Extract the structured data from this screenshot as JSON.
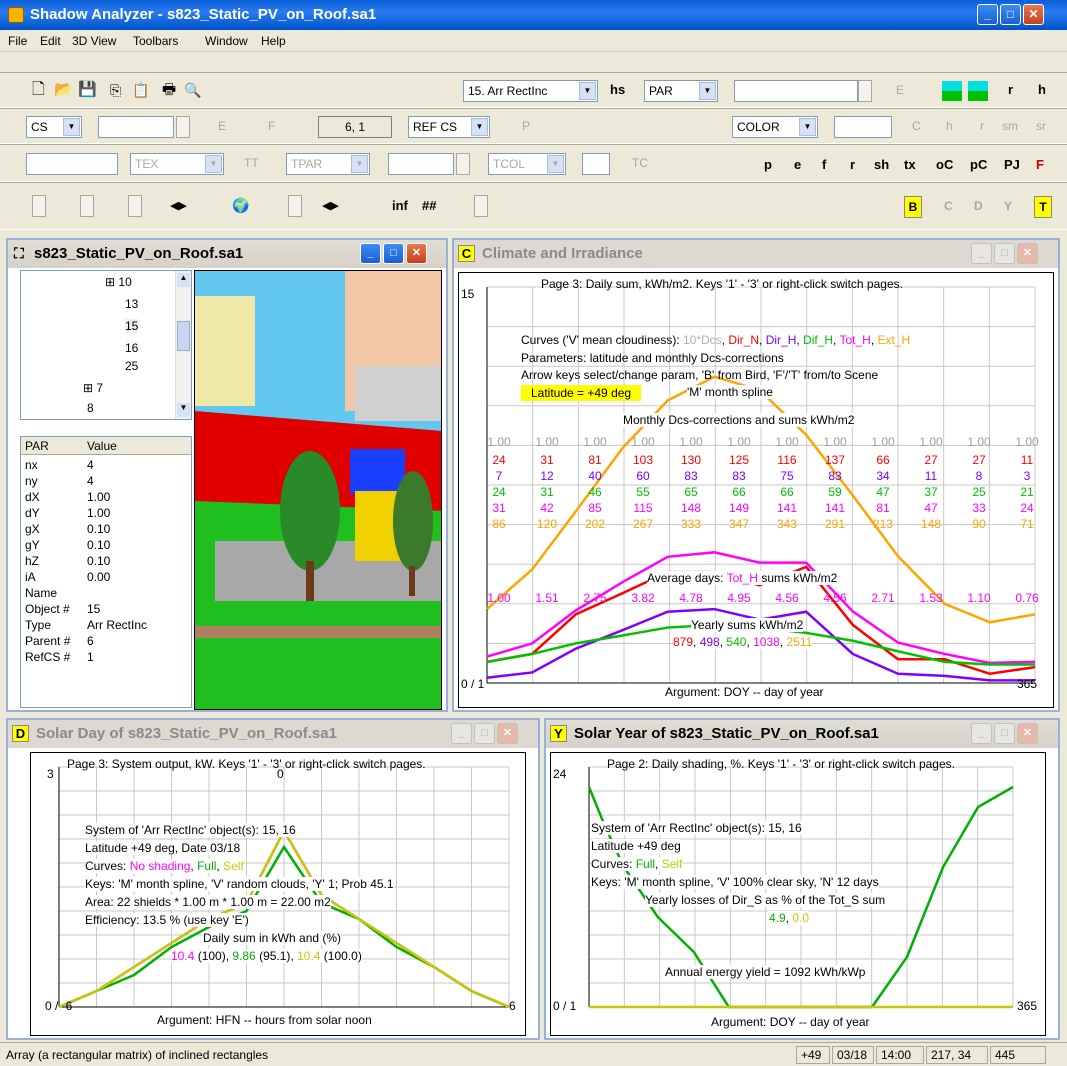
{
  "app": {
    "title": "Shadow Analyzer - s823_Static_PV_on_Roof.sa1"
  },
  "menu": [
    "File",
    "Edit",
    "3D View",
    "Toolbars",
    "Window",
    "Help"
  ],
  "toolbar1": {
    "combo_arr": "15. Arr RectInc",
    "hs": "hs",
    "combo_par": "PAR",
    "e": "E",
    "r": "r",
    "h": "h"
  },
  "toolbar2": {
    "cs": "CS",
    "e": "E",
    "f": "F",
    "coords": "6, 1",
    "refcs": "REF CS",
    "p": "P",
    "color": "COLOR",
    "c": "C",
    "h": "h",
    "r": "r",
    "sm": "sm",
    "sr": "sr"
  },
  "toolbar3": {
    "tex": "TEX",
    "tt": "TT",
    "tpar": "TPAR",
    "tcol": "TCOL",
    "tc": "TC",
    "btns": [
      "p",
      "e",
      "f",
      "r",
      "sh",
      "tx",
      "oC",
      "pC",
      "PJ",
      "F"
    ]
  },
  "toolbar4": {
    "inf": "inf",
    "hash": "##",
    "btns": [
      "B",
      "C",
      "D",
      "Y",
      "T"
    ]
  },
  "scene_window": {
    "title": "s823_Static_PV_on_Roof.sa1",
    "tree": [
      "10",
      "13",
      "15",
      "16",
      "25",
      "7",
      "8"
    ],
    "table_header": [
      "PAR",
      "Value"
    ],
    "rows": [
      [
        "nx",
        "4"
      ],
      [
        "ny",
        "4"
      ],
      [
        "dX",
        "1.00"
      ],
      [
        "dY",
        "1.00"
      ],
      [
        "gX",
        "0.10"
      ],
      [
        "gY",
        "0.10"
      ],
      [
        "hZ",
        "0.10"
      ],
      [
        "iA",
        "0.00"
      ],
      [
        "Name",
        ""
      ],
      [
        "Object #",
        "15"
      ],
      [
        "Type",
        "Arr RectInc"
      ],
      [
        "Parent #",
        "6"
      ],
      [
        "RefCS #",
        "1"
      ]
    ]
  },
  "climate_window": {
    "letter": "C",
    "title": "Climate and Irradiance",
    "header": "Page 3: Daily sum, kWh/m2. Keys '1' - '3' or right-click switch pages.",
    "y_max": "15",
    "origin": "0 / 1",
    "x_max": "365",
    "curves_prefix": "Curves ('V' mean cloudiness): ",
    "curves": [
      {
        "label": "10*Dcs",
        "color": "#b0b0b0"
      },
      {
        "label": "Dir_N",
        "color": "#ff0000"
      },
      {
        "label": "Dir_H",
        "color": "#8000ff"
      },
      {
        "label": "Dif_H",
        "color": "#00c000"
      },
      {
        "label": "Tot_H",
        "color": "#ff00ff"
      },
      {
        "label": "Ext_H",
        "color": "#ffa500"
      }
    ],
    "params": "Parameters: latitude and monthly Dcs-corrections",
    "arrows": "Arrow keys select/change param, 'B' from Bird, 'F'/'T' from/to Scene",
    "latitude": "Latitude = +49 deg",
    "spline": "'M' month spline",
    "monthly_title": "Monthly Dcs-corrections and sums kWh/m2",
    "dcs": [
      "1.00",
      "1.00",
      "1.00",
      "1.00",
      "1.00",
      "1.00",
      "1.00",
      "1.00",
      "1.00",
      "1.00",
      "1.00",
      "1.00"
    ],
    "dir_n": [
      "24",
      "31",
      "81",
      "103",
      "130",
      "125",
      "116",
      "137",
      "66",
      "27",
      "27",
      "11"
    ],
    "dir_h": [
      "7",
      "12",
      "40",
      "60",
      "83",
      "83",
      "75",
      "83",
      "34",
      "11",
      "8",
      "3"
    ],
    "dif_h": [
      "24",
      "31",
      "46",
      "55",
      "65",
      "66",
      "66",
      "59",
      "47",
      "37",
      "25",
      "21"
    ],
    "tot_h": [
      "31",
      "42",
      "85",
      "115",
      "148",
      "149",
      "141",
      "141",
      "81",
      "47",
      "33",
      "24"
    ],
    "ext_h": [
      "86",
      "120",
      "202",
      "267",
      "333",
      "347",
      "343",
      "291",
      "213",
      "148",
      "90",
      "71"
    ],
    "avg_title_prefix": "Average days: ",
    "avg_title_series": "Tot_H",
    "avg_title_suffix": " sums kWh/m2",
    "avg": [
      "1.00",
      "1.51",
      "2.75",
      "3.82",
      "4.78",
      "4.95",
      "4.56",
      "4.56",
      "2.71",
      "1.53",
      "1.10",
      "0.76"
    ],
    "yearly_title": "Yearly sums kWh/m2",
    "yearly": [
      "879",
      "498",
      "540",
      "1038",
      "2511"
    ],
    "xlabel": "Argument: DOY -- day of year"
  },
  "solar_day_window": {
    "letter": "D",
    "title": "Solar Day of s823_Static_PV_on_Roof.sa1",
    "header": "Page 3: System output, kW. Keys '1' - '3' or right-click switch pages.",
    "y_max": "3",
    "top_tick": "0",
    "origin": "0 / -6",
    "x_max": "6",
    "system": "System of 'Arr RectInc' object(s): 15, 16",
    "latitude": "Latitude +49 deg, Date 03/18",
    "curves_prefix": "Curves: ",
    "curves": [
      {
        "label": "No shading",
        "color": "#ff00ff"
      },
      {
        "label": "Full",
        "color": "#00b000"
      },
      {
        "label": "Self",
        "color": "#c8c800"
      }
    ],
    "keys": "Keys: 'M' month spline, 'V' random clouds, 'Y' 1; Prob 45.1",
    "area": "Area: 22 shields * 1.00 m * 1.00 m = 22.00 m2",
    "efficiency": "Efficiency: 13.5 % (use key 'E')",
    "daily_title": "Daily sum in kWh and (%)",
    "daily": [
      {
        "value": "10.4",
        "pct": " (100), ",
        "color": "#ff00ff"
      },
      {
        "value": "9.86",
        "pct": " (95.1), ",
        "color": "#00b000"
      },
      {
        "value": "10.4",
        "pct": " (100.0)",
        "color": "#c8c800"
      }
    ],
    "xlabel": "Argument: HFN -- hours from solar noon"
  },
  "solar_year_window": {
    "letter": "Y",
    "title": "Solar Year of s823_Static_PV_on_Roof.sa1",
    "header": "Page 2: Daily shading, %. Keys '1' - '3' or right-click switch pages.",
    "y_max": "24",
    "origin": "0 / 1",
    "x_max": "365",
    "system": "System of 'Arr RectInc' object(s): 15, 16",
    "latitude": "Latitude +49 deg",
    "curves_prefix": "Curves: ",
    "curves": [
      {
        "label": "Full",
        "color": "#00b000"
      },
      {
        "label": "Self",
        "color": "#c8c800"
      }
    ],
    "keys": "Keys: 'M' month spline, 'V' 100% clear sky, 'N' 12 days",
    "losses": "Yearly losses of Dir_S as % of the Tot_S sum",
    "losses_vals": [
      "4.9",
      "0.0"
    ],
    "annual": "Annual energy yield = 1092 kWh/kWp",
    "xlabel": "Argument: DOY -- day of year"
  },
  "statusbar": {
    "text": "Array (a rectangular matrix) of inclined rectangles",
    "lat": "+49",
    "date": "03/18",
    "time": "14:00",
    "pos": "217, 34",
    "num": "445"
  },
  "chart_data": [
    {
      "type": "line",
      "title": "Page 3: Daily sum, kWh/m2. Keys '1' - '3' or right-click switch pages.",
      "xlabel": "Argument: DOY -- day of year",
      "xlim": [
        1,
        365
      ],
      "ylim": [
        0,
        15
      ],
      "x": [
        1,
        31,
        60,
        91,
        121,
        152,
        182,
        213,
        244,
        274,
        305,
        335,
        365
      ],
      "series": [
        {
          "name": "Ext_H",
          "color": "#ffa500",
          "values": [
            2.8,
            4.3,
            6.5,
            8.9,
            10.7,
            11.6,
            11.1,
            9.4,
            7.1,
            4.8,
            3.0,
            2.3,
            2.6
          ]
        },
        {
          "name": "Tot_H",
          "color": "#ff00ff",
          "values": [
            1.0,
            1.5,
            2.75,
            3.82,
            4.78,
            4.95,
            4.56,
            4.56,
            2.71,
            1.53,
            1.1,
            0.76,
            0.8
          ]
        },
        {
          "name": "Dir_N",
          "color": "#ff0000",
          "values": [
            0.8,
            1.1,
            2.6,
            3.4,
            4.2,
            4.2,
            3.7,
            4.4,
            2.2,
            0.9,
            0.9,
            0.35,
            0.6
          ]
        },
        {
          "name": "Dir_H",
          "color": "#8000ff",
          "values": [
            0.2,
            0.4,
            1.3,
            2.0,
            2.7,
            2.8,
            2.4,
            2.7,
            1.1,
            0.35,
            0.27,
            0.1,
            0.1
          ]
        },
        {
          "name": "Dif_H",
          "color": "#00c000",
          "values": [
            0.8,
            1.1,
            1.5,
            1.8,
            2.1,
            2.2,
            2.1,
            1.9,
            1.6,
            1.2,
            0.8,
            0.7,
            0.7
          ]
        }
      ]
    },
    {
      "type": "line",
      "title": "Page 3: System output, kW. Keys '1' - '3' or right-click switch pages.",
      "xlabel": "Argument: HFN -- hours from solar noon",
      "xlim": [
        -6,
        6
      ],
      "ylim": [
        0,
        3
      ],
      "x": [
        -6,
        -5,
        -4,
        -3,
        -2,
        -1,
        0,
        1,
        2,
        3,
        4,
        5,
        6
      ],
      "series": [
        {
          "name": "No shading",
          "color": "#ff00ff",
          "values": [
            0.0,
            0.2,
            0.5,
            0.8,
            1.1,
            1.3,
            2.2,
            1.4,
            1.1,
            0.8,
            0.5,
            0.2,
            0.0
          ]
        },
        {
          "name": "Full",
          "color": "#00b000",
          "values": [
            0.0,
            0.2,
            0.4,
            0.75,
            1.0,
            1.2,
            2.0,
            1.3,
            1.1,
            0.75,
            0.5,
            0.2,
            0.0
          ]
        },
        {
          "name": "Self",
          "color": "#c8c800",
          "values": [
            0.0,
            0.2,
            0.5,
            0.8,
            1.1,
            1.3,
            2.2,
            1.4,
            1.1,
            0.8,
            0.5,
            0.2,
            0.0
          ]
        }
      ]
    },
    {
      "type": "line",
      "title": "Page 2: Daily shading, %. Keys '1' - '3' or right-click switch pages.",
      "xlabel": "Argument: DOY -- day of year",
      "xlim": [
        1,
        365
      ],
      "ylim": [
        0,
        24
      ],
      "x": [
        1,
        15,
        31,
        60,
        91,
        121,
        152,
        182,
        213,
        244,
        274,
        305,
        335,
        365
      ],
      "series": [
        {
          "name": "Full",
          "color": "#00b000",
          "values": [
            22,
            18,
            14,
            9,
            5.5,
            0,
            0,
            0,
            0,
            0,
            5,
            14,
            20,
            22
          ]
        },
        {
          "name": "Self",
          "color": "#c8c800",
          "values": [
            0,
            0,
            0,
            0,
            0,
            0,
            0,
            0,
            0,
            0,
            0,
            0,
            0,
            0
          ]
        }
      ]
    }
  ]
}
